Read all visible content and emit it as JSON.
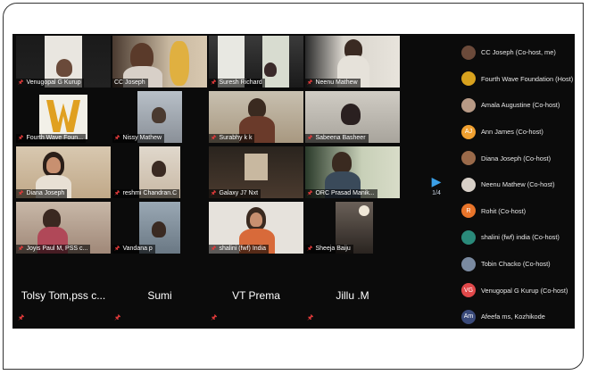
{
  "tiles": [
    {
      "name": "Venugopal G Kurup",
      "active": true
    },
    {
      "name": "CC Joseph"
    },
    {
      "name": "Suresh Richard"
    },
    {
      "name": "Neenu Mathew"
    },
    {
      "name": "Fourth Wave Foun..."
    },
    {
      "name": "Nissy Mathew"
    },
    {
      "name": "Surabhy k k"
    },
    {
      "name": "Sabeena Basheer"
    },
    {
      "name": "Diana Joseph"
    },
    {
      "name": "reshmi Chandran.C"
    },
    {
      "name": "Galaxy J7 Nxt"
    },
    {
      "name": "ORC Prasad Manik..."
    },
    {
      "name": "Joyis Paul M, PSS c..."
    },
    {
      "name": "Vandana p"
    },
    {
      "name": "shalini (fwf) India"
    },
    {
      "name": "Sheeja Baiju"
    }
  ],
  "name_tiles": [
    "Tolsy Tom,pss c...",
    "Sumi",
    "VT Prema",
    "Jillu .M"
  ],
  "pager": {
    "page": "1/4"
  },
  "participants": [
    {
      "name": "CC Joseph (Co-host, me)",
      "avatar_color": "#6b4a3a",
      "initials": ""
    },
    {
      "name": "Fourth Wave Foundation (Host)",
      "avatar_color": "#d8a21e",
      "initials": ""
    },
    {
      "name": "Amala Augustine (Co-host)",
      "avatar_color": "#b89a86",
      "initials": ""
    },
    {
      "name": "Ann James (Co-host)",
      "avatar_color": "#f0a030",
      "initials": "AJ"
    },
    {
      "name": "Diana Joseph (Co-host)",
      "avatar_color": "#9a6a4a",
      "initials": ""
    },
    {
      "name": "Neenu Mathew (Co-host)",
      "avatar_color": "#d8d0c8",
      "initials": ""
    },
    {
      "name": "Rohit (Co-host)",
      "avatar_color": "#e8742a",
      "initials": "R"
    },
    {
      "name": "shalini (fwf) india (Co-host)",
      "avatar_color": "#2a8a7a",
      "initials": ""
    },
    {
      "name": "Tobin Chacko (Co-host)",
      "avatar_color": "#7a8aa0",
      "initials": ""
    },
    {
      "name": "Venugopal G Kurup (Co-host)",
      "avatar_color": "#e0484a",
      "initials": "VG"
    },
    {
      "name": "Afeefa ms, Kozhikode",
      "avatar_color": "#3a4a7a",
      "initials": "Am"
    }
  ]
}
